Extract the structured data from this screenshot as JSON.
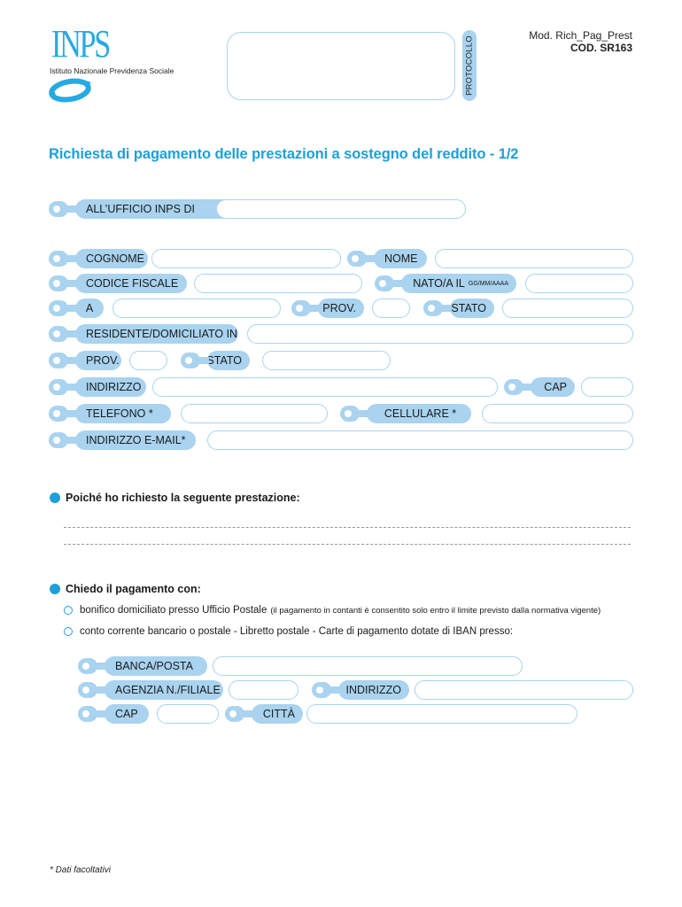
{
  "header": {
    "logo_text": "INPS",
    "logo_subtitle": "Istituto Nazionale Previdenza Sociale",
    "protocol_label": "PROTOCOLLO",
    "model": "Mod. Rich_Pag_Prest",
    "code": "COD. SR163"
  },
  "title": "Richiesta di pagamento delle prestazioni a sostegno del reddito - 1/2",
  "applicant": {
    "office_label": "ALL’UFFICIO INPS DI",
    "surname_label": "COGNOME",
    "name_label": "NOME",
    "tax_code_label": "CODICE FISCALE",
    "birth_label": "NATO/A IL",
    "birth_format": "GG/MM/AAAA",
    "birthplace_label": "A",
    "birth_prov_label": "PROV.",
    "birth_country_label": "STATO",
    "residence_label": "RESIDENTE/DOMICILIATO IN",
    "res_prov_label": "PROV.",
    "res_country_label": "STATO",
    "address_label": "INDIRIZZO",
    "zip_label": "CAP",
    "phone_label": "TELEFONO *",
    "mobile_label": "CELLULARE *",
    "email_label": "INDIRIZZO E-MAIL*",
    "values": {
      "office": "",
      "surname": "",
      "name": "",
      "tax_code": "",
      "birth_date": "",
      "birthplace": "",
      "birth_prov": "",
      "birth_country": "",
      "residence": "",
      "res_prov": "",
      "res_country": "",
      "address": "",
      "zip": "",
      "phone": "",
      "mobile": "",
      "email": ""
    }
  },
  "benefit_section": {
    "heading": "Poiché ho richiesto la seguente prestazione:"
  },
  "payment_section": {
    "heading": "Chiedo il pagamento con:",
    "options": [
      {
        "label": "bonifico domiciliato presso Ufficio Postale",
        "note": "(il pagamento in contanti è consentito solo entro il limite previsto dalla normativa vigente)",
        "selected": false
      },
      {
        "label": "conto corrente bancario o postale - Libretto postale - Carte di pagamento dotate di IBAN presso:",
        "note": "",
        "selected": false
      }
    ],
    "bank_label": "BANCA/POSTA",
    "branch_label": "AGENZIA N./FILIALE",
    "bank_address_label": "INDIRIZZO",
    "bank_zip_label": "CAP",
    "bank_city_label": "CITTÀ"
  },
  "footer": {
    "note": "* Dati facoltativi"
  },
  "colors": {
    "accent": "#1e9fda",
    "label_fill": "#a9d3ef",
    "logo": "#27a9e1"
  }
}
